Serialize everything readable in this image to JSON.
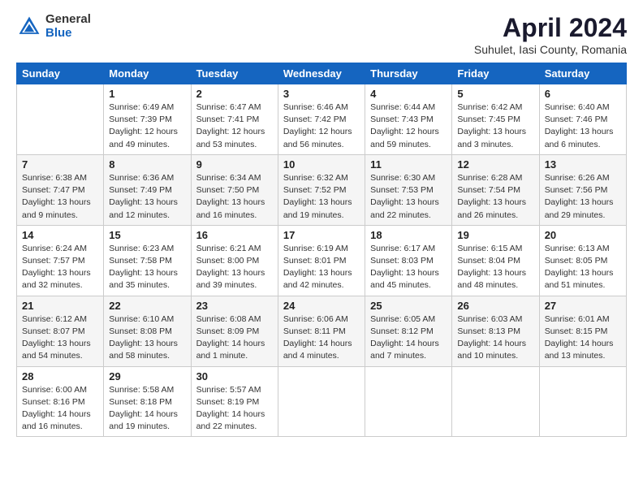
{
  "header": {
    "logo_general": "General",
    "logo_blue": "Blue",
    "month_title": "April 2024",
    "location": "Suhulet, Iasi County, Romania"
  },
  "weekdays": [
    "Sunday",
    "Monday",
    "Tuesday",
    "Wednesday",
    "Thursday",
    "Friday",
    "Saturday"
  ],
  "weeks": [
    [
      {
        "day": "",
        "info": ""
      },
      {
        "day": "1",
        "info": "Sunrise: 6:49 AM\nSunset: 7:39 PM\nDaylight: 12 hours\nand 49 minutes."
      },
      {
        "day": "2",
        "info": "Sunrise: 6:47 AM\nSunset: 7:41 PM\nDaylight: 12 hours\nand 53 minutes."
      },
      {
        "day": "3",
        "info": "Sunrise: 6:46 AM\nSunset: 7:42 PM\nDaylight: 12 hours\nand 56 minutes."
      },
      {
        "day": "4",
        "info": "Sunrise: 6:44 AM\nSunset: 7:43 PM\nDaylight: 12 hours\nand 59 minutes."
      },
      {
        "day": "5",
        "info": "Sunrise: 6:42 AM\nSunset: 7:45 PM\nDaylight: 13 hours\nand 3 minutes."
      },
      {
        "day": "6",
        "info": "Sunrise: 6:40 AM\nSunset: 7:46 PM\nDaylight: 13 hours\nand 6 minutes."
      }
    ],
    [
      {
        "day": "7",
        "info": "Sunrise: 6:38 AM\nSunset: 7:47 PM\nDaylight: 13 hours\nand 9 minutes."
      },
      {
        "day": "8",
        "info": "Sunrise: 6:36 AM\nSunset: 7:49 PM\nDaylight: 13 hours\nand 12 minutes."
      },
      {
        "day": "9",
        "info": "Sunrise: 6:34 AM\nSunset: 7:50 PM\nDaylight: 13 hours\nand 16 minutes."
      },
      {
        "day": "10",
        "info": "Sunrise: 6:32 AM\nSunset: 7:52 PM\nDaylight: 13 hours\nand 19 minutes."
      },
      {
        "day": "11",
        "info": "Sunrise: 6:30 AM\nSunset: 7:53 PM\nDaylight: 13 hours\nand 22 minutes."
      },
      {
        "day": "12",
        "info": "Sunrise: 6:28 AM\nSunset: 7:54 PM\nDaylight: 13 hours\nand 26 minutes."
      },
      {
        "day": "13",
        "info": "Sunrise: 6:26 AM\nSunset: 7:56 PM\nDaylight: 13 hours\nand 29 minutes."
      }
    ],
    [
      {
        "day": "14",
        "info": "Sunrise: 6:24 AM\nSunset: 7:57 PM\nDaylight: 13 hours\nand 32 minutes."
      },
      {
        "day": "15",
        "info": "Sunrise: 6:23 AM\nSunset: 7:58 PM\nDaylight: 13 hours\nand 35 minutes."
      },
      {
        "day": "16",
        "info": "Sunrise: 6:21 AM\nSunset: 8:00 PM\nDaylight: 13 hours\nand 39 minutes."
      },
      {
        "day": "17",
        "info": "Sunrise: 6:19 AM\nSunset: 8:01 PM\nDaylight: 13 hours\nand 42 minutes."
      },
      {
        "day": "18",
        "info": "Sunrise: 6:17 AM\nSunset: 8:03 PM\nDaylight: 13 hours\nand 45 minutes."
      },
      {
        "day": "19",
        "info": "Sunrise: 6:15 AM\nSunset: 8:04 PM\nDaylight: 13 hours\nand 48 minutes."
      },
      {
        "day": "20",
        "info": "Sunrise: 6:13 AM\nSunset: 8:05 PM\nDaylight: 13 hours\nand 51 minutes."
      }
    ],
    [
      {
        "day": "21",
        "info": "Sunrise: 6:12 AM\nSunset: 8:07 PM\nDaylight: 13 hours\nand 54 minutes."
      },
      {
        "day": "22",
        "info": "Sunrise: 6:10 AM\nSunset: 8:08 PM\nDaylight: 13 hours\nand 58 minutes."
      },
      {
        "day": "23",
        "info": "Sunrise: 6:08 AM\nSunset: 8:09 PM\nDaylight: 14 hours\nand 1 minute."
      },
      {
        "day": "24",
        "info": "Sunrise: 6:06 AM\nSunset: 8:11 PM\nDaylight: 14 hours\nand 4 minutes."
      },
      {
        "day": "25",
        "info": "Sunrise: 6:05 AM\nSunset: 8:12 PM\nDaylight: 14 hours\nand 7 minutes."
      },
      {
        "day": "26",
        "info": "Sunrise: 6:03 AM\nSunset: 8:13 PM\nDaylight: 14 hours\nand 10 minutes."
      },
      {
        "day": "27",
        "info": "Sunrise: 6:01 AM\nSunset: 8:15 PM\nDaylight: 14 hours\nand 13 minutes."
      }
    ],
    [
      {
        "day": "28",
        "info": "Sunrise: 6:00 AM\nSunset: 8:16 PM\nDaylight: 14 hours\nand 16 minutes."
      },
      {
        "day": "29",
        "info": "Sunrise: 5:58 AM\nSunset: 8:18 PM\nDaylight: 14 hours\nand 19 minutes."
      },
      {
        "day": "30",
        "info": "Sunrise: 5:57 AM\nSunset: 8:19 PM\nDaylight: 14 hours\nand 22 minutes."
      },
      {
        "day": "",
        "info": ""
      },
      {
        "day": "",
        "info": ""
      },
      {
        "day": "",
        "info": ""
      },
      {
        "day": "",
        "info": ""
      }
    ]
  ]
}
